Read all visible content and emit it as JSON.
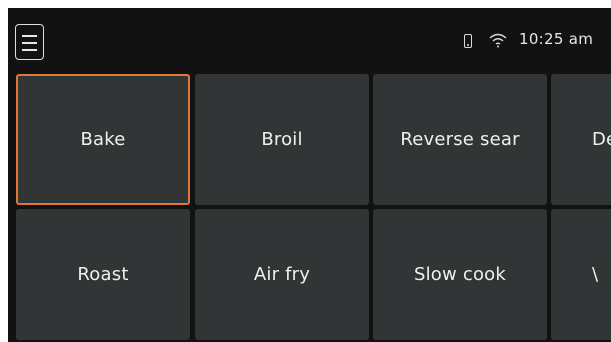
{
  "header": {
    "time": "10:25 am",
    "status_icons": [
      "phone-icon",
      "wifi-icon"
    ],
    "menu_icon": "hamburger-menu-icon"
  },
  "modes": {
    "selected_color": "#e2763a",
    "items": [
      {
        "label": "Bake",
        "selected": true
      },
      {
        "label": "Broil"
      },
      {
        "label": "Reverse sear"
      },
      {
        "label": "De"
      },
      {
        "label": "Roast"
      },
      {
        "label": "Air fry"
      },
      {
        "label": "Slow cook"
      },
      {
        "label": "\\"
      }
    ]
  }
}
